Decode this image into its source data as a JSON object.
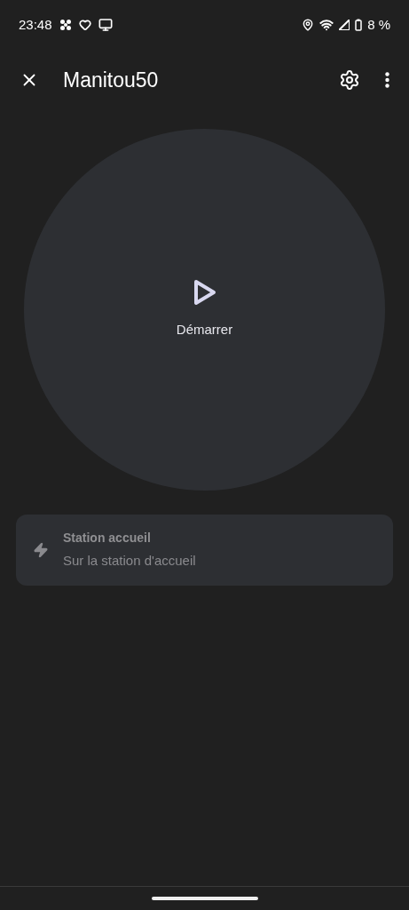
{
  "status_bar": {
    "time": "23:48",
    "battery": "8 %"
  },
  "app_bar": {
    "title": "Manitou50"
  },
  "start_button": {
    "label": "Démarrer"
  },
  "status_card": {
    "title": "Station accueil",
    "subtitle": "Sur la station d'accueil"
  }
}
